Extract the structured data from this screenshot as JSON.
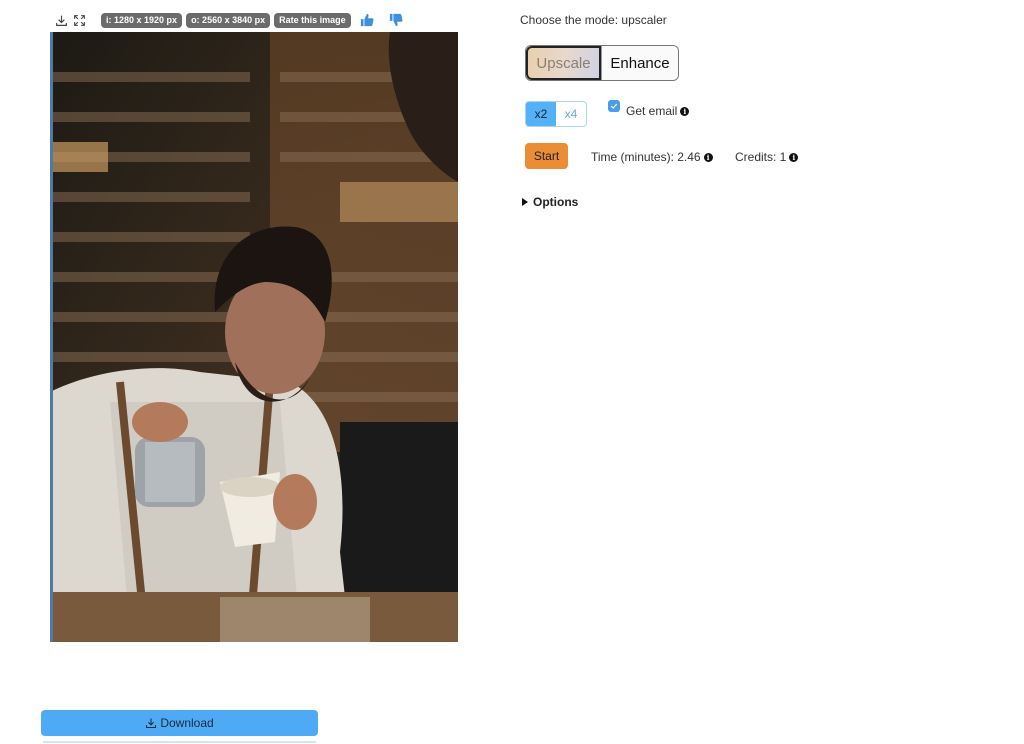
{
  "toolbar": {
    "download_icon": "download-icon",
    "fullscreen_icon": "fullscreen-icon",
    "input_size": "i: 1280 x 1920 px",
    "output_size": "o: 2560 x 3840 px",
    "rate_label": "Rate this image",
    "thumbs_up_icon": "thumbs-up-icon",
    "thumbs_down_icon": "thumbs-down-icon"
  },
  "image": {
    "description": "Barista pouring milk into a paper cup in a cafe"
  },
  "download": {
    "label": "Download"
  },
  "mode": {
    "label": "Choose the mode: upscaler",
    "options": [
      "Upscale",
      "Enhance"
    ],
    "selected": "Upscale"
  },
  "scale": {
    "options": [
      "x2",
      "x4"
    ],
    "selected": "x2"
  },
  "email": {
    "label": "Get email",
    "checked": true
  },
  "start": {
    "label": "Start"
  },
  "time": {
    "label": "Time (minutes): 2.46"
  },
  "credits": {
    "label": "Credits: 1"
  },
  "options": {
    "label": "Options"
  },
  "colors": {
    "accent_blue": "#4faaf5",
    "start_orange": "#ea8d35",
    "chip_gray": "#6b6b6b"
  }
}
